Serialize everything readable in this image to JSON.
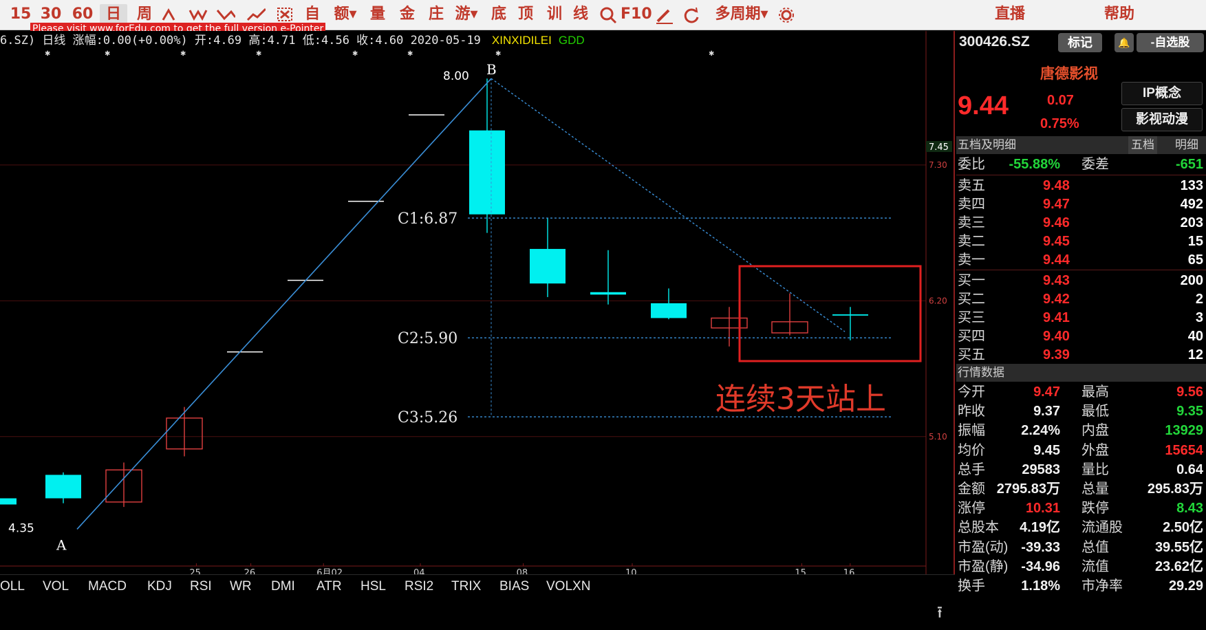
{
  "toolbar": {
    "items": [
      {
        "label": "15",
        "kind": "period"
      },
      {
        "label": "30",
        "kind": "period"
      },
      {
        "label": "60",
        "kind": "period"
      },
      {
        "label": "日",
        "kind": "period",
        "active": true
      },
      {
        "label": "周",
        "kind": "period"
      },
      {
        "label": "",
        "kind": "icon",
        "icon": "pattern-up-icon"
      },
      {
        "label": "",
        "kind": "icon",
        "icon": "pattern-w-icon"
      },
      {
        "label": "",
        "kind": "icon",
        "icon": "pattern-down-icon"
      },
      {
        "label": "",
        "kind": "icon",
        "icon": "pattern-trend-icon"
      },
      {
        "label": "",
        "kind": "icon",
        "icon": "box-select-icon"
      },
      {
        "label": "自",
        "kind": "text"
      },
      {
        "label": "额▾",
        "kind": "text"
      },
      {
        "label": "量",
        "kind": "text"
      },
      {
        "label": "金",
        "kind": "text"
      },
      {
        "label": "庄",
        "kind": "text"
      },
      {
        "label": "游▾",
        "kind": "text"
      },
      {
        "label": "底",
        "kind": "text"
      },
      {
        "label": "顶",
        "kind": "text"
      },
      {
        "label": "训",
        "kind": "text"
      },
      {
        "label": "线",
        "kind": "text"
      },
      {
        "label": "",
        "kind": "icon",
        "icon": "zoom-icon"
      },
      {
        "label": "F10",
        "kind": "text"
      },
      {
        "label": "",
        "kind": "icon",
        "icon": "pencil-icon"
      },
      {
        "label": "",
        "kind": "icon",
        "icon": "refresh-icon"
      },
      {
        "label": "多周期▾",
        "kind": "text"
      },
      {
        "label": "",
        "kind": "icon",
        "icon": "gear-icon"
      },
      {
        "label": "直播",
        "kind": "text"
      },
      {
        "label": "帮助",
        "kind": "text"
      }
    ],
    "watermark": "Please visit www.forEdu.com to get the full version e-Pointer"
  },
  "info_bar": {
    "text": "6.SZ) 日线 涨幅:0.00(+0.00%)  开:4.69  高:4.71  低:4.56  收:4.60  2020-05-19",
    "indicator1": "XINXIDILEI",
    "indicator2": "GDD"
  },
  "chart_data": {
    "type": "candlestick",
    "candles": [
      {
        "open": 4.55,
        "close": 4.6,
        "high": 4.71,
        "low": 4.56,
        "color": "cyan"
      },
      {
        "open": 4.79,
        "close": 4.6,
        "high": 4.81,
        "low": 4.56,
        "color": "cyan"
      },
      {
        "open": 4.57,
        "close": 4.83,
        "high": 4.89,
        "low": 4.53,
        "color": "red"
      },
      {
        "open": 5.0,
        "close": 5.25,
        "high": 5.34,
        "low": 4.94,
        "color": "red"
      },
      {
        "open": 5.79,
        "close": 5.79,
        "high": 5.79,
        "low": 5.79,
        "color": "white"
      },
      {
        "open": 6.37,
        "close": 6.37,
        "high": 6.37,
        "low": 6.37,
        "color": "white"
      },
      {
        "open": 7.01,
        "close": 7.01,
        "high": 7.01,
        "low": 7.01,
        "color": "white"
      },
      {
        "open": 7.71,
        "close": 7.71,
        "high": 7.71,
        "low": 7.71,
        "color": "white"
      },
      {
        "open": 7.58,
        "close": 6.9,
        "high": 8.0,
        "low": 6.75,
        "color": "cyan"
      },
      {
        "open": 6.62,
        "close": 6.34,
        "high": 6.87,
        "low": 6.23,
        "color": "cyan"
      },
      {
        "open": 6.27,
        "close": 6.25,
        "high": 6.61,
        "low": 6.17,
        "color": "cyan"
      },
      {
        "open": 6.18,
        "close": 6.06,
        "high": 6.3,
        "low": 6.05,
        "color": "cyan"
      },
      {
        "open": 5.98,
        "close": 6.06,
        "high": 6.15,
        "low": 5.83,
        "color": "red"
      },
      {
        "open": 5.94,
        "close": 6.03,
        "high": 6.26,
        "low": 5.92,
        "color": "red"
      },
      {
        "open": 6.08,
        "close": 6.09,
        "high": 6.15,
        "low": 5.88,
        "color": "cyan"
      }
    ],
    "x_labels": [
      "25",
      "26",
      "6月02",
      "04",
      "08",
      "10",
      "15",
      "16"
    ],
    "y_ticks": [
      "7.30",
      "6.20",
      "5.10"
    ],
    "current_price_tag": "7.45",
    "swing_low": {
      "label": "A",
      "price_label": "4.35"
    },
    "swing_high": {
      "label": "B",
      "price_label": "8.00"
    },
    "projection_levels": [
      {
        "label": "C1:6.87",
        "value": 6.87
      },
      {
        "label": "C2:5.90",
        "value": 5.9
      },
      {
        "label": "C3:5.26",
        "value": 5.26
      }
    ],
    "annotation": "连续3天站上"
  },
  "indicator_tabs": [
    "OLL",
    "VOL",
    "MACD",
    "KDJ",
    "RSI",
    "WR",
    "DMI",
    "ATR",
    "HSL",
    "RSI2",
    "TRIX",
    "BIAS",
    "VOLXN"
  ],
  "panel": {
    "code": "300426.SZ",
    "mark_label": "标记",
    "bell_label": "🔔",
    "watchlist_label": "-自选股",
    "name": "唐德影视",
    "price": "9.44",
    "change": "0.07",
    "change_pct": "0.75%",
    "tags": [
      "IP概念",
      "影视动漫"
    ],
    "orderbook_header": "五档及明细",
    "orderbook_tab1": "五档",
    "orderbook_tab2": "明细",
    "weibi": {
      "label": "委比",
      "value": "-55.88%",
      "label2": "委差",
      "value2": "-651"
    },
    "asks": [
      {
        "label": "卖五",
        "price": "9.48",
        "vol": "133"
      },
      {
        "label": "卖四",
        "price": "9.47",
        "vol": "492"
      },
      {
        "label": "卖三",
        "price": "9.46",
        "vol": "203"
      },
      {
        "label": "卖二",
        "price": "9.45",
        "vol": "15"
      },
      {
        "label": "卖一",
        "price": "9.44",
        "vol": "65"
      }
    ],
    "bids": [
      {
        "label": "买一",
        "price": "9.43",
        "vol": "200"
      },
      {
        "label": "买二",
        "price": "9.42",
        "vol": "2"
      },
      {
        "label": "买三",
        "price": "9.41",
        "vol": "3"
      },
      {
        "label": "买四",
        "price": "9.40",
        "vol": "40"
      },
      {
        "label": "买五",
        "price": "9.39",
        "vol": "12"
      }
    ],
    "market_header": "行情数据",
    "market": [
      {
        "l1": "今开",
        "v1": "9.47",
        "c1": "red",
        "l2": "最高",
        "v2": "9.56",
        "c2": "red"
      },
      {
        "l1": "昨收",
        "v1": "9.37",
        "c1": "white",
        "l2": "最低",
        "v2": "9.35",
        "c2": "green"
      },
      {
        "l1": "振幅",
        "v1": "2.24%",
        "c1": "white",
        "l2": "内盘",
        "v2": "13929",
        "c2": "green"
      },
      {
        "l1": "均价",
        "v1": "9.45",
        "c1": "white",
        "l2": "外盘",
        "v2": "15654",
        "c2": "red"
      },
      {
        "l1": "总手",
        "v1": "29583",
        "c1": "white",
        "l2": "量比",
        "v2": "0.64",
        "c2": "white"
      },
      {
        "l1": "金额",
        "v1": "2795.83万",
        "c1": "white",
        "l2": "总量",
        "v2": "295.83万",
        "c2": "white"
      },
      {
        "l1": "涨停",
        "v1": "10.31",
        "c1": "red",
        "l2": "跌停",
        "v2": "8.43",
        "c2": "green"
      },
      {
        "l1": "总股本",
        "v1": "4.19亿",
        "c1": "white",
        "l2": "流通股",
        "v2": "2.50亿",
        "c2": "white"
      },
      {
        "l1": "市盈(动)",
        "v1": "-39.33",
        "c1": "white",
        "l2": "总值",
        "v2": "39.55亿",
        "c2": "white"
      },
      {
        "l1": "市盈(静)",
        "v1": "-34.96",
        "c1": "white",
        "l2": "流值",
        "v2": "23.62亿",
        "c2": "white"
      },
      {
        "l1": "换手",
        "v1": "1.18%",
        "c1": "white",
        "l2": "市净率",
        "v2": "29.29",
        "c2": "white"
      }
    ]
  }
}
